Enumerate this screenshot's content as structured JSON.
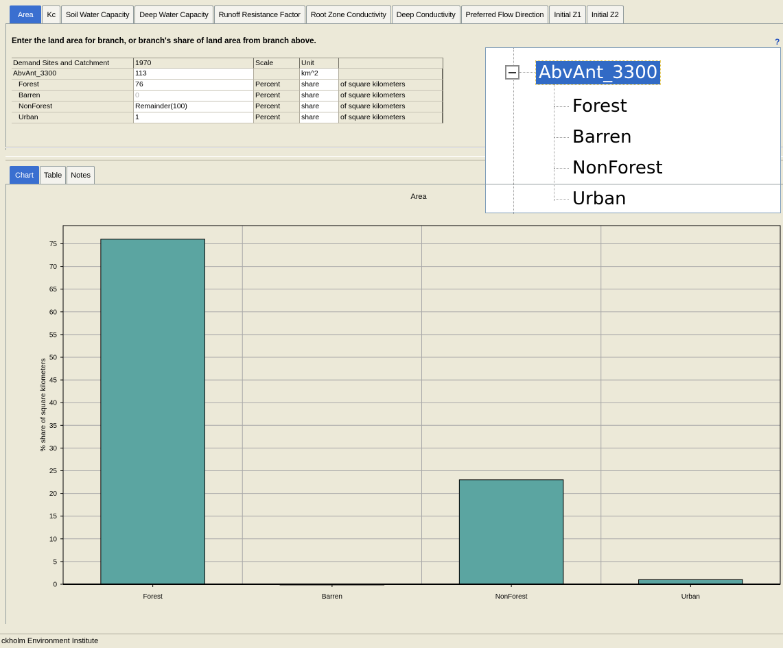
{
  "top_tabs": [
    "Area",
    "Kc",
    "Soil Water Capacity",
    "Deep Water Capacity",
    "Runoff Resistance Factor",
    "Root Zone Conductivity",
    "Deep Conductivity",
    "Preferred Flow Direction",
    "Initial Z1",
    "Initial Z2"
  ],
  "active_top_tab": "Area",
  "instruction": "Enter the land area for branch, or branch's share of land area from branch above.",
  "help_icon": "?",
  "grid": {
    "headers": [
      "Demand Sites and Catchment",
      "1970",
      "Scale",
      "Unit",
      ""
    ],
    "rows": [
      {
        "name": "AbvAnt_3300",
        "value": "113",
        "scale": "",
        "unit": "km^2",
        "desc": ""
      },
      {
        "name": "Forest",
        "value": "76",
        "scale": "Percent",
        "unit": "share",
        "desc": "of square kilometers"
      },
      {
        "name": "Barren",
        "value": "0",
        "scale": "Percent",
        "unit": "share",
        "desc": "of square kilometers"
      },
      {
        "name": "NonForest",
        "value": "Remainder(100)",
        "scale": "Percent",
        "unit": "share",
        "desc": "of square kilometers"
      },
      {
        "name": "Urban",
        "value": "1",
        "scale": "Percent",
        "unit": "share",
        "desc": "of square kilometers"
      }
    ]
  },
  "tree": {
    "root": "AbvAnt_3300",
    "children": [
      "Forest",
      "Barren",
      "NonForest",
      "Urban"
    ]
  },
  "lower_tabs": [
    "Chart",
    "Table",
    "Notes"
  ],
  "active_lower_tab": "Chart",
  "chart_data": {
    "type": "bar",
    "title": "Area",
    "categories": [
      "Forest",
      "Barren",
      "NonForest",
      "Urban"
    ],
    "values": [
      76,
      0,
      23,
      1
    ],
    "ylabel": "% share of square kilometers",
    "xlabel": "",
    "ylim": [
      0,
      79
    ],
    "yticks": [
      0,
      5,
      10,
      15,
      20,
      25,
      30,
      35,
      40,
      45,
      50,
      55,
      60,
      65,
      70,
      75
    ],
    "grid": true,
    "bar_color": "#5ba5a1"
  },
  "status_text": "ckholm Environment Institute"
}
